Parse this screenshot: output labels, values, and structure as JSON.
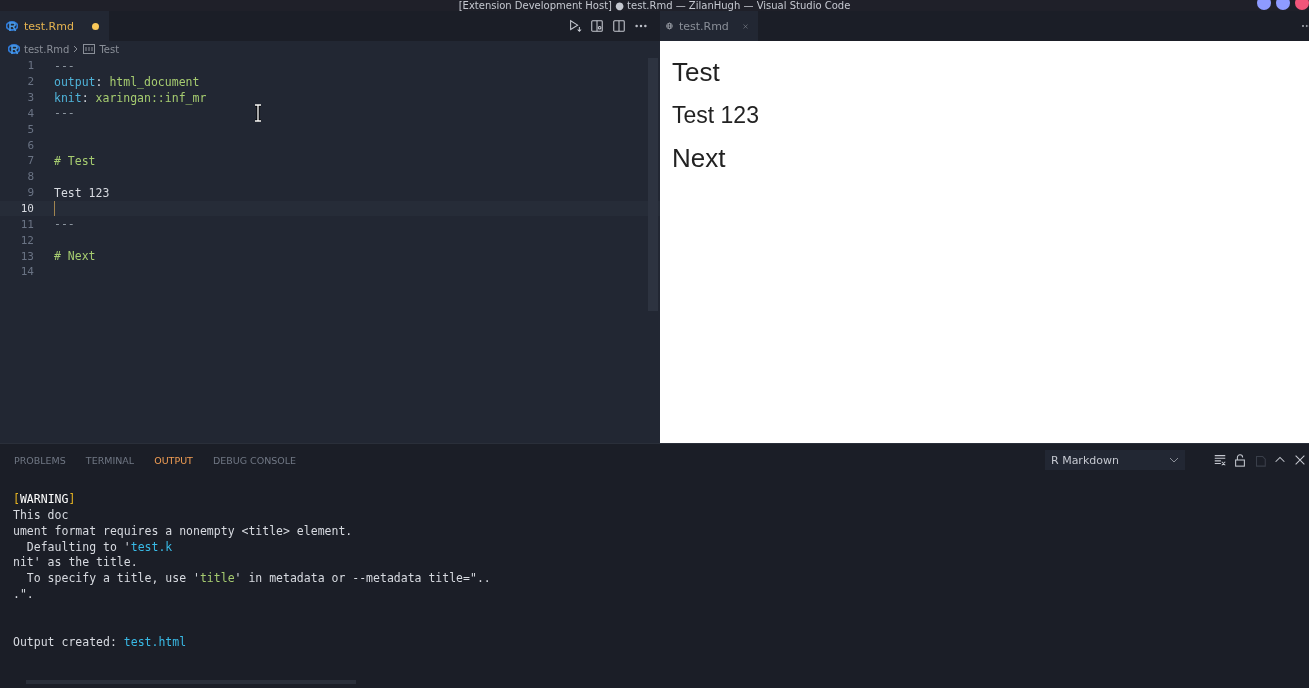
{
  "window": {
    "title": "[Extension Development Host]  ● test.Rmd — ZilanHugh — Visual Studio Code"
  },
  "editor": {
    "tab": {
      "label": "test.Rmd",
      "dirty": true,
      "selected": true
    },
    "breadcrumbs": [
      {
        "label": "test.Rmd",
        "kind": "file"
      },
      {
        "label": "Test",
        "kind": "symbol"
      }
    ],
    "lines": [
      {
        "number": "1",
        "current": false,
        "tokens": [
          {
            "text": "---",
            "kind": "punct"
          }
        ]
      },
      {
        "number": "2",
        "current": false,
        "tokens": [
          {
            "text": "output",
            "kind": "key"
          },
          {
            "text": ": ",
            "kind": "plain"
          },
          {
            "text": "html_document",
            "kind": "value"
          }
        ]
      },
      {
        "number": "3",
        "current": false,
        "tokens": [
          {
            "text": "knit",
            "kind": "key"
          },
          {
            "text": ": ",
            "kind": "plain"
          },
          {
            "text": "xaringan::inf_mr",
            "kind": "value"
          }
        ]
      },
      {
        "number": "4",
        "current": false,
        "tokens": [
          {
            "text": "---",
            "kind": "punct"
          }
        ]
      },
      {
        "number": "5",
        "current": false
      },
      {
        "number": "6",
        "current": false
      },
      {
        "number": "7",
        "current": false,
        "tokens": [
          {
            "text": "# Test",
            "kind": "heading"
          }
        ]
      },
      {
        "number": "8",
        "current": false
      },
      {
        "number": "9",
        "current": false,
        "tokens": [
          {
            "text": "Test 123",
            "kind": "plain"
          }
        ]
      },
      {
        "number": "10",
        "current": true
      },
      {
        "number": "11",
        "current": false,
        "tokens": [
          {
            "text": "---",
            "kind": "punct"
          }
        ]
      },
      {
        "number": "12",
        "current": false
      },
      {
        "number": "13",
        "current": false,
        "tokens": [
          {
            "text": "# Next",
            "kind": "heading"
          }
        ]
      },
      {
        "number": "14",
        "current": false
      }
    ]
  },
  "preview": {
    "tab": {
      "label": "test.Rmd",
      "selected": true
    },
    "blocks": [
      {
        "text": "Test",
        "kind": "h1"
      },
      {
        "text": "Test 123",
        "kind": "p"
      },
      {
        "text": "Next",
        "kind": "h1"
      }
    ]
  },
  "panel": {
    "tabs": [
      {
        "label": "PROBLEMS",
        "selected": false
      },
      {
        "label": "TERMINAL",
        "selected": false
      },
      {
        "label": "OUTPUT",
        "selected": true
      },
      {
        "label": "DEBUG CONSOLE",
        "selected": false
      }
    ],
    "channel": {
      "value": "R Markdown"
    },
    "output": [
      {
        "kind": "text",
        "tokens": [
          {
            "text": "[",
            "kind": "bracket"
          },
          {
            "text": "WARNING",
            "kind": "bright"
          },
          {
            "text": "]",
            "kind": "bracket"
          }
        ]
      },
      {
        "kind": "text",
        "tokens": [
          {
            "text": "This doc",
            "kind": "plain"
          }
        ]
      },
      {
        "kind": "text",
        "tokens": [
          {
            "text": "ument format requires a nonempty <title> element.",
            "kind": "plain"
          }
        ]
      },
      {
        "kind": "text",
        "tokens": [
          {
            "text": "  Defaulting to '",
            "kind": "plain"
          },
          {
            "text": "test.k",
            "kind": "link"
          }
        ]
      },
      {
        "kind": "text",
        "tokens": [
          {
            "text": "nit' as the title.",
            "kind": "plain"
          }
        ]
      },
      {
        "kind": "text",
        "tokens": [
          {
            "text": "  To specify a title, use '",
            "kind": "plain"
          },
          {
            "text": "title",
            "kind": "string"
          },
          {
            "text": "' in metadata or --metadata title=\"..",
            "kind": "plain"
          }
        ]
      },
      {
        "kind": "text",
        "tokens": [
          {
            "text": ".\".",
            "kind": "plain"
          }
        ]
      },
      {
        "kind": "blank"
      },
      {
        "kind": "blank"
      },
      {
        "kind": "text",
        "tokens": [
          {
            "text": "Output created: ",
            "kind": "plain"
          },
          {
            "text": "test.html",
            "kind": "link"
          }
        ]
      }
    ]
  }
}
